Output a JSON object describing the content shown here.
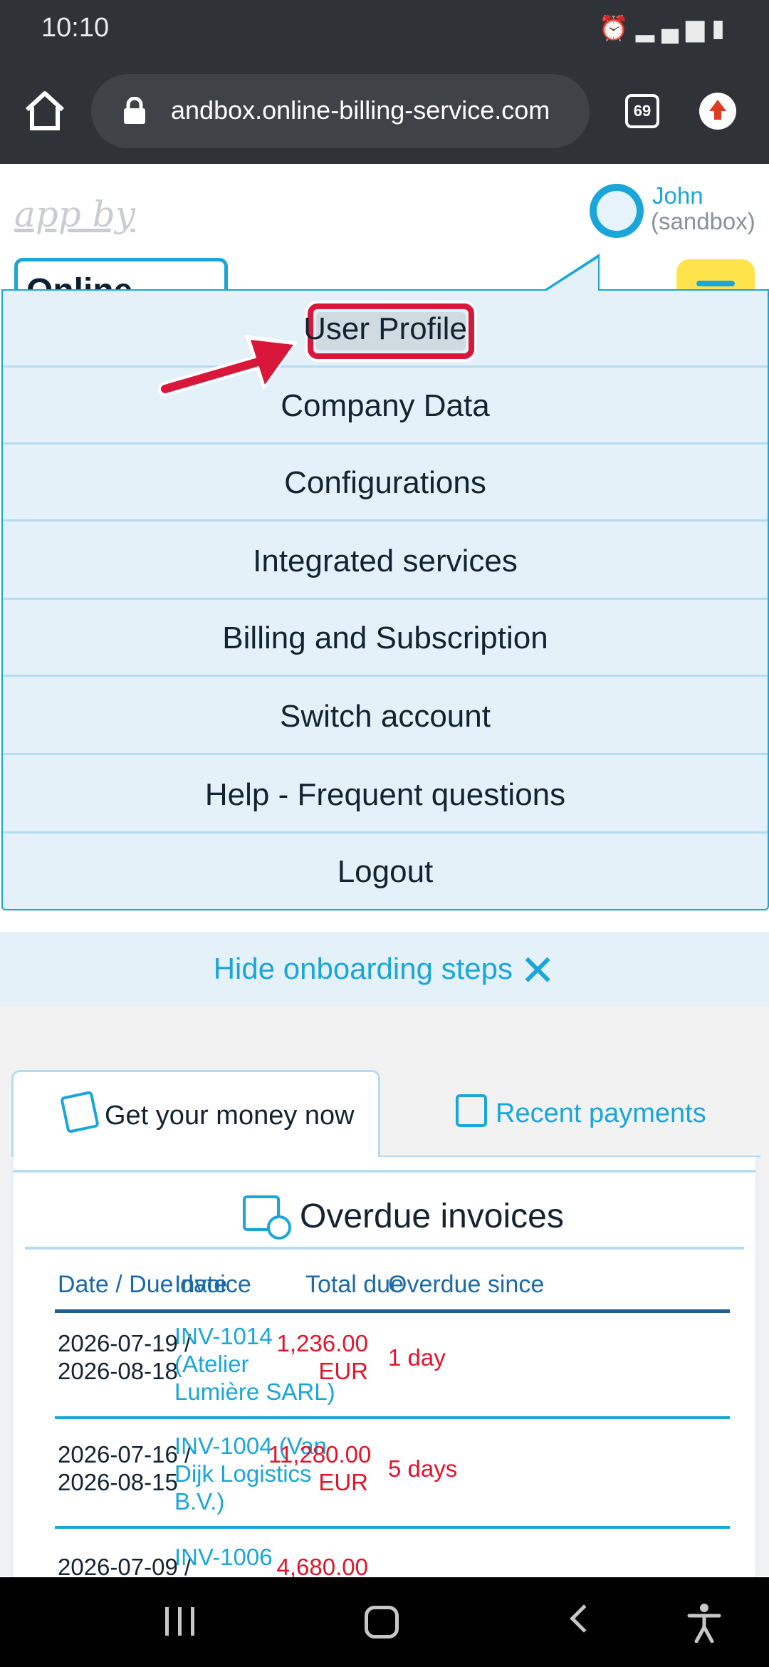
{
  "status_bar": {
    "time": "10:10",
    "icons": [
      "alarm-icon",
      "mute-icon",
      "data-icon",
      "signal-icon",
      "battery-icon"
    ]
  },
  "browser": {
    "url": "andbox.online-billing-service.com",
    "tab_count": "69"
  },
  "header": {
    "app_by": "app by",
    "logo_text": "Online-billing",
    "user_name": "John",
    "user_sub": "(sandbox)"
  },
  "menu": {
    "items": [
      {
        "label": "User Profile"
      },
      {
        "label": "Company Data"
      },
      {
        "label": "Configurations"
      },
      {
        "label": "Integrated services"
      },
      {
        "label": "Billing and Subscription"
      },
      {
        "label": "Switch account"
      },
      {
        "label": "Help - Frequent questions"
      },
      {
        "label": "Logout"
      }
    ]
  },
  "onboarding": {
    "hide_label": "Hide onboarding steps"
  },
  "tabs": {
    "active": "Get your money now",
    "inactive": "Recent payments"
  },
  "overdue": {
    "title": "Overdue invoices",
    "columns": [
      "Date / Due date",
      "Invoice",
      "Total due",
      "Overdue since"
    ],
    "rows": [
      {
        "date": "2026-07-19 / 2026-08-18",
        "invoice": "INV-1014 (Atelier Lumière SARL)",
        "total": "1,236.00 EUR",
        "since": "1 day"
      },
      {
        "date": "2026-07-16 / 2026-08-15",
        "invoice": "INV-1004 (Van Dijk Logistics B.V.)",
        "total": "11,280.00 EUR",
        "since": "5 days"
      },
      {
        "date": "2026-07-09 /",
        "invoice": "INV-1006",
        "total": "4,680.00",
        "since": ""
      }
    ]
  },
  "colors": {
    "accent": "#1aa6d8",
    "overdue_red": "#e0142b",
    "highlight": "#d8173b",
    "menu_bg": "#e4f1f9"
  }
}
